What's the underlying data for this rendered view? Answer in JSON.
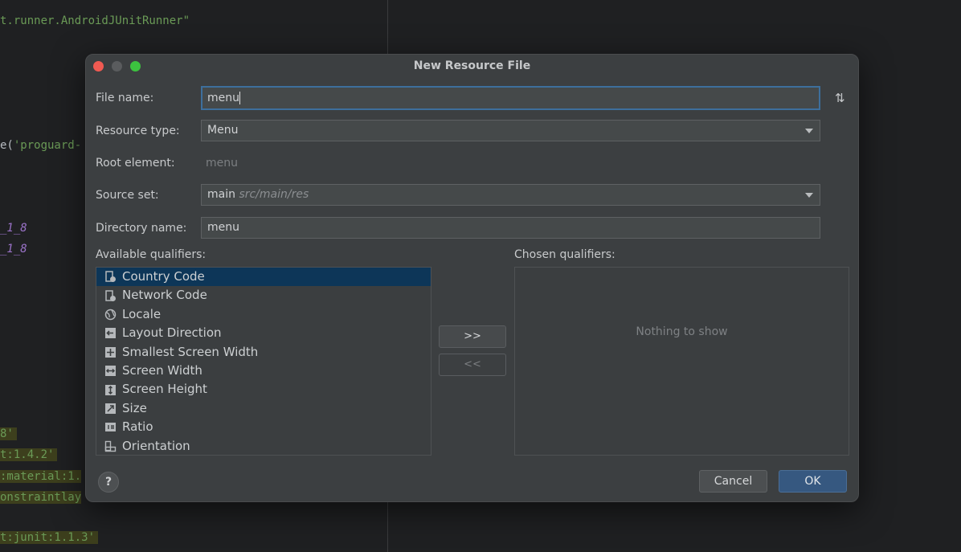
{
  "editor": {
    "lines": [
      {
        "text": "t.runner.AndroidJUnitRunner\"",
        "color": "green"
      },
      {
        "text": "e('proguard-",
        "color": "mixed"
      },
      {
        "text": "_1_8",
        "color": "purple"
      },
      {
        "text": "_1_8",
        "color": "purple"
      },
      {
        "text": "8'",
        "color": "green"
      },
      {
        "text": "t:1.4.2'",
        "color": "green"
      },
      {
        "text": ":material:1.",
        "color": "green"
      },
      {
        "text": "onstraintlay",
        "color": "green"
      },
      {
        "text": "t:junit:1.1.3'",
        "color": "green"
      }
    ]
  },
  "dialog": {
    "title": "New Resource File",
    "file_name": {
      "label": "File name:",
      "value": "menu"
    },
    "resource_type": {
      "label": "Resource type:",
      "value": "Menu"
    },
    "root_element": {
      "label": "Root element:",
      "value": "menu"
    },
    "source_set": {
      "label": "Source set:",
      "value": "main",
      "path": "src/main/res"
    },
    "directory_name": {
      "label": "Directory name:",
      "value": "menu"
    },
    "available_qualifiers": {
      "label": "Available qualifiers:",
      "items": [
        {
          "label": "Country Code",
          "icon": "country-code-icon",
          "selected": true
        },
        {
          "label": "Network Code",
          "icon": "network-code-icon",
          "selected": false
        },
        {
          "label": "Locale",
          "icon": "globe-icon",
          "selected": false
        },
        {
          "label": "Layout Direction",
          "icon": "layout-direction-icon",
          "selected": false
        },
        {
          "label": "Smallest Screen Width",
          "icon": "smallest-screen-width-icon",
          "selected": false
        },
        {
          "label": "Screen Width",
          "icon": "screen-width-icon",
          "selected": false
        },
        {
          "label": "Screen Height",
          "icon": "screen-height-icon",
          "selected": false
        },
        {
          "label": "Size",
          "icon": "size-icon",
          "selected": false
        },
        {
          "label": "Ratio",
          "icon": "ratio-icon",
          "selected": false
        },
        {
          "label": "Orientation",
          "icon": "orientation-icon",
          "selected": false
        }
      ]
    },
    "add_button": ">>",
    "remove_button": "<<",
    "chosen_qualifiers": {
      "label": "Chosen qualifiers:",
      "empty_text": "Nothing to show"
    },
    "help": "?",
    "cancel": "Cancel",
    "ok": "OK"
  }
}
